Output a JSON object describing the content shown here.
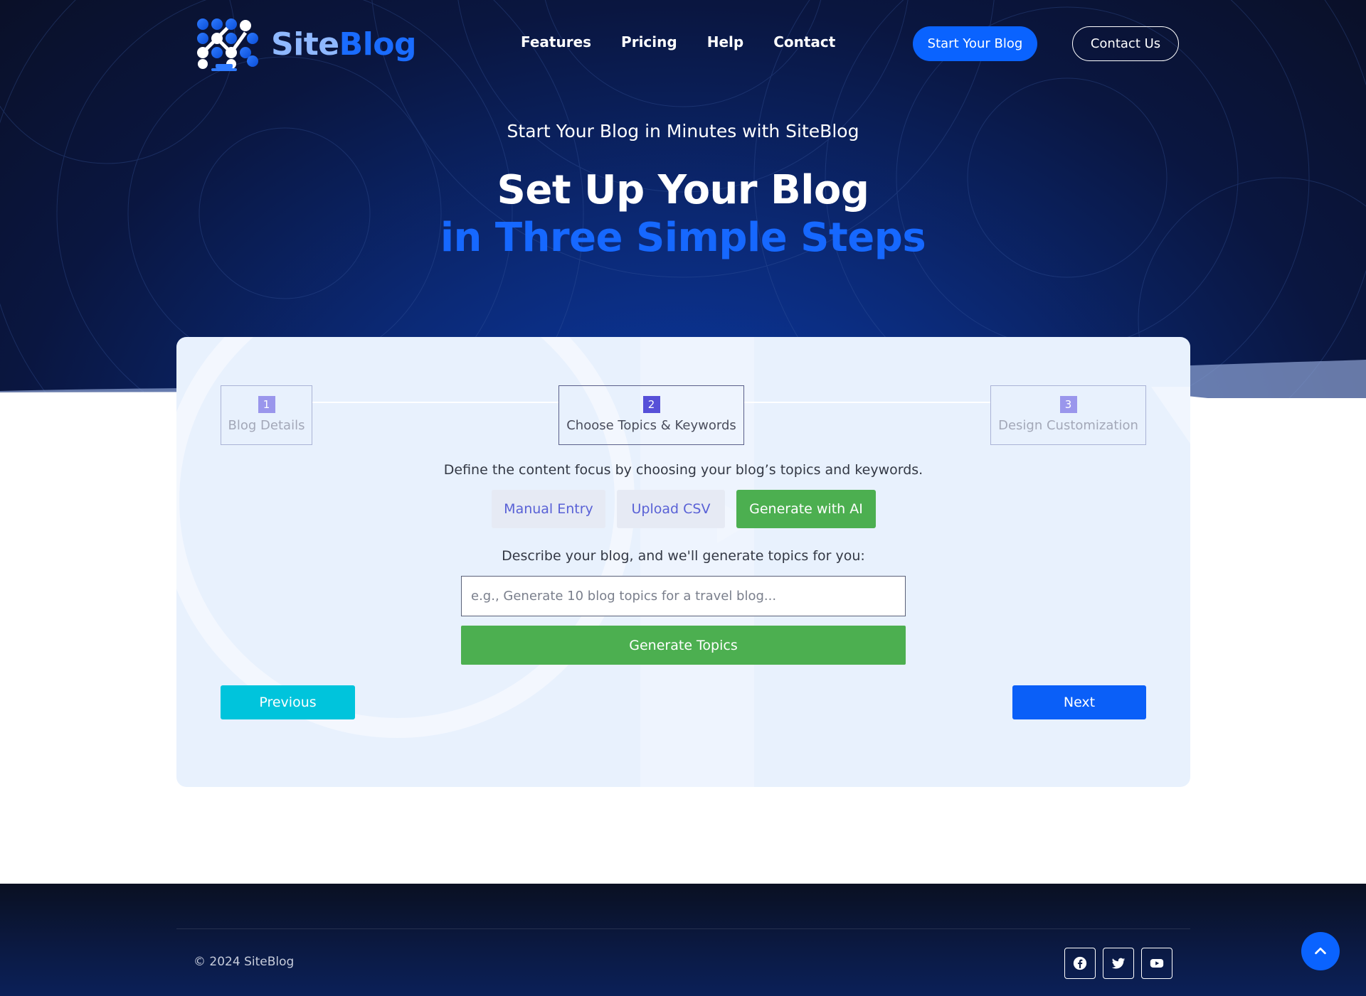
{
  "header": {
    "brand_part1": "Site",
    "brand_part2": "Blog",
    "nav": [
      "Features",
      "Pricing",
      "Help",
      "Contact"
    ],
    "start_button": "Start Your Blog",
    "contact_button": "Contact Us"
  },
  "hero": {
    "subtitle": "Start Your Blog in Minutes with SiteBlog",
    "title_line1": "Set Up Your Blog",
    "title_line2": "in Three Simple Steps"
  },
  "wizard": {
    "current_step": 2,
    "steps": [
      {
        "number": "1",
        "label": "Blog Details"
      },
      {
        "number": "2",
        "label": "Choose Topics & Keywords"
      },
      {
        "number": "3",
        "label": "Design Customization"
      }
    ],
    "description": "Define the content focus by choosing your blog’s topics and keywords.",
    "tabs": [
      "Manual Entry",
      "Upload CSV",
      "Generate with AI"
    ],
    "active_tab": "Generate with AI",
    "prompt_label": "Describe your blog, and we'll generate topics for you:",
    "prompt_placeholder": "e.g., Generate 10 blog topics for a travel blog...",
    "prompt_value": "",
    "generate_button": "Generate Topics",
    "previous_button": "Previous",
    "next_button": "Next"
  },
  "footer": {
    "copyright": "© 2024 SiteBlog",
    "social": [
      "facebook-icon",
      "twitter-icon",
      "youtube-icon"
    ]
  },
  "colors": {
    "brand_blue": "#0a63ff",
    "green": "#4caf50",
    "cyan": "#00c4dc",
    "step_active": "#5750d8",
    "step_inactive": "#9a96ec"
  }
}
